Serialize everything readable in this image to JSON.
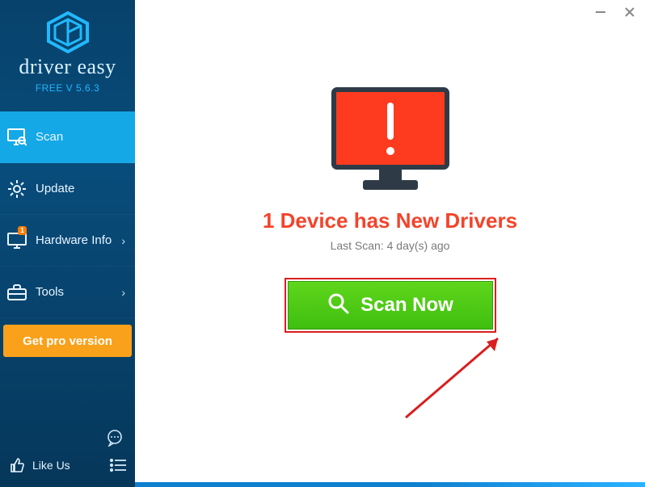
{
  "brand": {
    "name": "driver easy",
    "version_label": "FREE V 5.6.3"
  },
  "sidebar": {
    "items": [
      {
        "label": "Scan"
      },
      {
        "label": "Update"
      },
      {
        "label": "Hardware Info",
        "badge": "1"
      },
      {
        "label": "Tools"
      }
    ],
    "pro_button": "Get pro version",
    "like_label": "Like Us"
  },
  "main": {
    "status_headline": "1 Device has New Drivers",
    "last_scan": "Last Scan: 4 day(s) ago",
    "scan_button": "Scan Now"
  },
  "colors": {
    "sidebar_bg": "#084c7b",
    "sidebar_active": "#14a8e6",
    "pro_btn": "#f9a11b",
    "alert_red": "#f3442b",
    "scan_green": "#3fbf0f",
    "annot_red": "#d91f1f"
  }
}
